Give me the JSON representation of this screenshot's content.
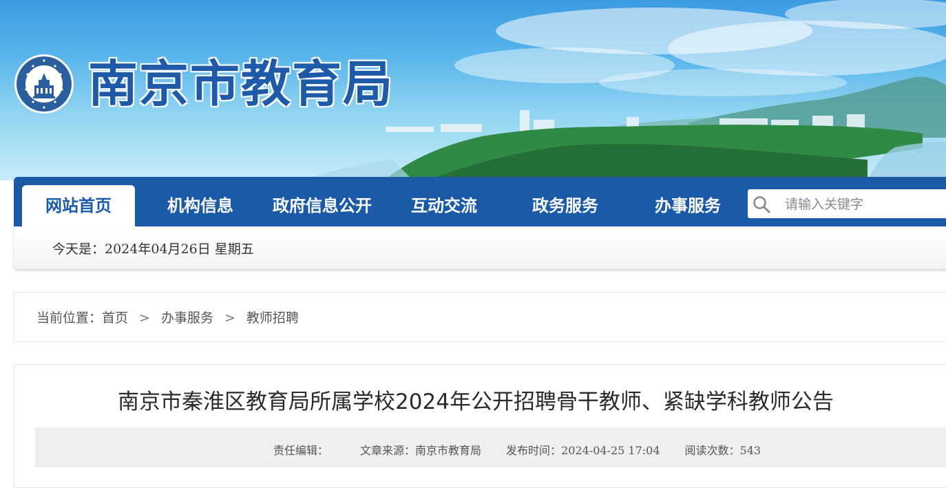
{
  "header": {
    "site_title": "南京市教育局",
    "emblem_icon": "nanjing-education-emblem-icon",
    "emblem_text": "CHINA NANJING EDUCATION"
  },
  "nav": {
    "items": [
      {
        "label": "网站首页",
        "active": true
      },
      {
        "label": "机构信息",
        "active": false
      },
      {
        "label": "政府信息公开",
        "active": false
      },
      {
        "label": "互动交流",
        "active": false
      },
      {
        "label": "政务服务",
        "active": false
      },
      {
        "label": "办事服务",
        "active": false
      }
    ],
    "search": {
      "placeholder": "请输入关键字",
      "icon": "search-icon"
    }
  },
  "datebar": {
    "text": "今天是：2024年04月26日 星期五"
  },
  "breadcrumb": {
    "prefix": "当前位置：",
    "items": [
      "首页",
      "办事服务",
      "教师招聘"
    ],
    "separator": ">"
  },
  "article": {
    "title": "南京市秦淮区教育局所属学校2024年公开招聘骨干教师、紧缺学科教师公告",
    "meta": {
      "editor_label": "责任编辑：",
      "editor_value": "",
      "source_label": "文章来源：",
      "source_value": "南京市教育局",
      "time_label": "发布时间：",
      "time_value": "2024-04-25 17:04",
      "views_label": "阅读次数：",
      "views_value": "543"
    }
  },
  "colors": {
    "nav_blue": "#1a5aa6",
    "title_blue": "#1e5aa8"
  }
}
